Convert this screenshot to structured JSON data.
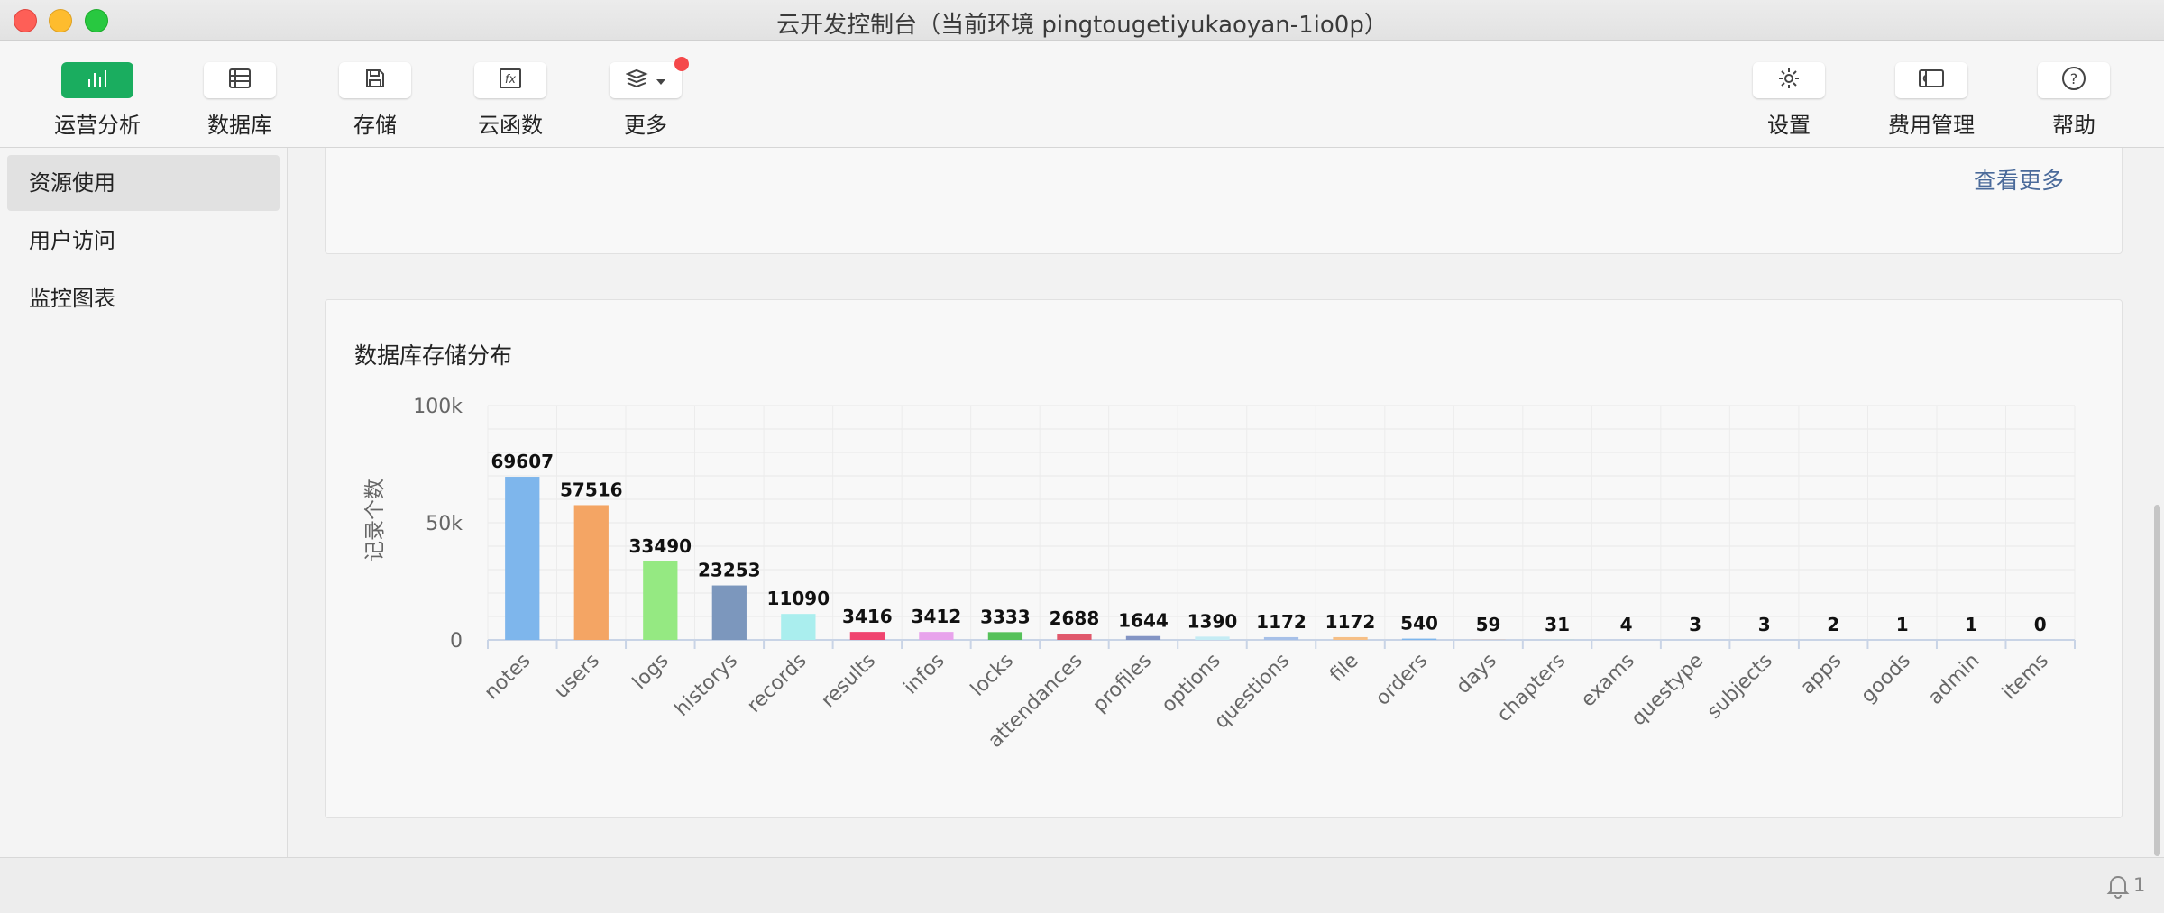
{
  "window": {
    "title": "云开发控制台（当前环境 pingtougetiyukaoyan-1io0p）"
  },
  "toolbar": {
    "left_items": [
      {
        "label": "运营分析",
        "icon": "bar-chart-icon",
        "active": true
      },
      {
        "label": "数据库",
        "icon": "database-icon",
        "active": false
      },
      {
        "label": "存储",
        "icon": "storage-icon",
        "active": false
      },
      {
        "label": "云函数",
        "icon": "function-icon",
        "active": false
      },
      {
        "label": "更多",
        "icon": "layers-icon",
        "active": false,
        "has_badge": true
      }
    ],
    "right_items": [
      {
        "label": "设置",
        "icon": "gear-icon"
      },
      {
        "label": "费用管理",
        "icon": "wallet-icon"
      },
      {
        "label": "帮助",
        "icon": "help-icon"
      }
    ]
  },
  "sidebar": {
    "items": [
      {
        "label": "资源使用",
        "active": true
      },
      {
        "label": "用户访问",
        "active": false
      },
      {
        "label": "监控图表",
        "active": false
      }
    ]
  },
  "main": {
    "view_more_label": "查看更多",
    "chart_title": "数据库存储分布"
  },
  "statusbar": {
    "notification_count": "1"
  },
  "colors": {
    "accent": "#1aad5f",
    "badge": "#f5484a",
    "link": "#4a6a9a"
  },
  "chart_data": {
    "type": "bar",
    "title": "数据库存储分布",
    "ylabel": "记录个数",
    "xlabel": "",
    "ylim": [
      0,
      100000
    ],
    "yticks": [
      "0",
      "50k",
      "100k"
    ],
    "yticks_values": [
      0,
      50000,
      100000
    ],
    "grid": true,
    "categories": [
      "notes",
      "users",
      "logs",
      "historys",
      "records",
      "results",
      "infos",
      "locks",
      "attendances",
      "profiles",
      "options",
      "questions",
      "file",
      "orders",
      "days",
      "chapters",
      "exams",
      "questype",
      "subjects",
      "apps",
      "goods",
      "admin",
      "items"
    ],
    "values": [
      69607,
      57516,
      33490,
      23253,
      11090,
      3416,
      3412,
      3333,
      2688,
      1644,
      1390,
      1172,
      1172,
      540,
      59,
      31,
      4,
      3,
      3,
      2,
      1,
      1,
      0
    ],
    "colors": [
      "#7eb6ec",
      "#f4a564",
      "#95e982",
      "#7c97bd",
      "#aaeeee",
      "#f0446f",
      "#e8a3ec",
      "#56c15a",
      "#e0586c",
      "#8394c4",
      "#c5ecf4",
      "#a7c0e8",
      "#f6bf86",
      "#7eb6ec",
      "#f4a564",
      "#95e982",
      "#7c97bd",
      "#aaeeee",
      "#f0446f",
      "#e8a3ec",
      "#56c15a",
      "#e0586c",
      "#8394c4"
    ]
  }
}
